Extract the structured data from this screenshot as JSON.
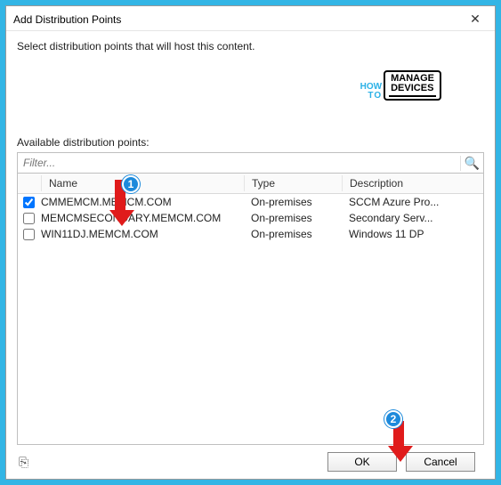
{
  "dialog": {
    "title": "Add Distribution Points",
    "instruction": "Select distribution points that will host this content.",
    "close_glyph": "✕"
  },
  "filter": {
    "placeholder": "Filter...",
    "search_icon_glyph": "🔍"
  },
  "labels": {
    "available": "Available distribution points:"
  },
  "columns": {
    "name": "Name",
    "type": "Type",
    "description": "Description"
  },
  "rows": [
    {
      "checked": true,
      "name": "CMMEMCM.MEMCM.COM",
      "type": "On-premises",
      "description": "SCCM Azure Pro..."
    },
    {
      "checked": false,
      "name": "MEMCMSECONDARY.MEMCM.COM",
      "type": "On-premises",
      "description": "Secondary Serv..."
    },
    {
      "checked": false,
      "name": "WIN11DJ.MEMCM.COM",
      "type": "On-premises",
      "description": "Windows 11 DP"
    }
  ],
  "buttons": {
    "ok": "OK",
    "cancel": "Cancel"
  },
  "logo": {
    "how": "HOW",
    "to": "TO",
    "manage": "MANAGE",
    "devices": "DEVICES"
  },
  "annotations": {
    "b1": "1",
    "b2": "2"
  },
  "corner_icon_glyph": "⎘"
}
